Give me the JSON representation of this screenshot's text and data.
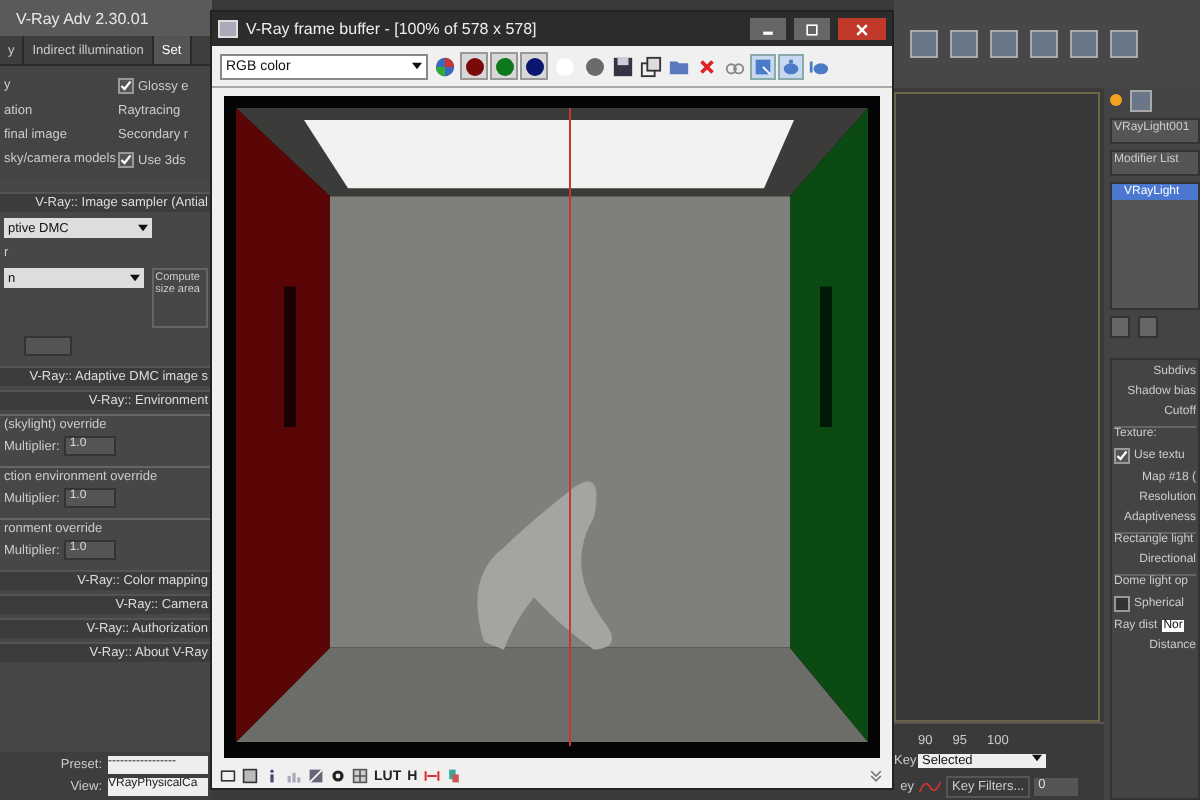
{
  "render_setup": {
    "title": "V-Ray Adv 2.30.01",
    "tabs": [
      {
        "label": "y",
        "selected": false
      },
      {
        "label": "Indirect illumination",
        "selected": false
      },
      {
        "label": "Set",
        "selected": true
      }
    ],
    "rows": [
      {
        "kind": "check-pair",
        "left": "y",
        "right": "Glossy e",
        "checked": true
      },
      {
        "kind": "pair",
        "left": "ation",
        "right": "Raytracing"
      },
      {
        "kind": "pair",
        "left": "final image",
        "right": "Secondary r"
      },
      {
        "kind": "check-pair",
        "left": "sky/camera models",
        "right": "Use 3ds",
        "checked": true
      }
    ],
    "items": [
      {
        "kind": "header",
        "title": "V-Ray:: Image sampler (Antial"
      },
      {
        "kind": "dropdown",
        "value": "ptive DMC"
      },
      {
        "kind": "label",
        "text": "r"
      },
      {
        "kind": "dropdown-note",
        "value": "n",
        "note": "Compute size area"
      },
      {
        "kind": "spinner"
      },
      {
        "kind": "header",
        "title": "V-Ray:: Adaptive DMC image s"
      },
      {
        "kind": "header",
        "title": "V-Ray:: Environment"
      },
      {
        "kind": "group",
        "title": "(skylight) override",
        "label": "Multiplier:",
        "value": "1.0"
      },
      {
        "kind": "group",
        "title": "ction environment override",
        "label": "Multiplier:",
        "value": "1.0"
      },
      {
        "kind": "group",
        "title": "ronment override",
        "label": "Multiplier:",
        "value": "1.0"
      },
      {
        "kind": "header",
        "title": "V-Ray:: Color mapping"
      },
      {
        "kind": "header",
        "title": "V-Ray:: Camera"
      },
      {
        "kind": "header",
        "title": "V-Ray:: Authorization"
      },
      {
        "kind": "header",
        "title": "V-Ray:: About V-Ray"
      }
    ],
    "preset": {
      "label": "Preset:",
      "value": "-----------------"
    },
    "view": {
      "label": "View:",
      "value": "VRayPhysicalCa"
    }
  },
  "frame_buffer": {
    "title": "V-Ray frame buffer - [100% of 578 x 578]",
    "channel_dropdown": "RGB color",
    "channels": [
      {
        "color": "#7a0a0a",
        "selected": true
      },
      {
        "color": "#0c7a1c",
        "selected": true
      },
      {
        "color": "#0a1670",
        "selected": true
      },
      {
        "color": "#ffffff",
        "selected": false
      },
      {
        "color": "#6a6a6a",
        "selected": false
      }
    ],
    "bottom_labels": [
      "LUT",
      "H"
    ]
  },
  "timeline": {
    "ticks": [
      "90",
      "95",
      "100"
    ],
    "key_labels": [
      "Key",
      "ey"
    ],
    "key_mode": "Selected",
    "key_filters": "Key Filters...",
    "frame": "0"
  },
  "command_panel": {
    "object_name": "VRayLight001",
    "modifier_list": "Modifier List",
    "stack": [
      {
        "label": "VRayLight",
        "selected": true
      }
    ],
    "params": [
      {
        "kind": "label",
        "text": "Subdivs"
      },
      {
        "kind": "label",
        "text": "Shadow bias"
      },
      {
        "kind": "label",
        "text": "Cutoff"
      },
      {
        "kind": "group",
        "text": "Texture:"
      },
      {
        "kind": "check",
        "text": "Use textu",
        "checked": true
      },
      {
        "kind": "label",
        "text": "Map #18 ("
      },
      {
        "kind": "label",
        "text": "Resolution"
      },
      {
        "kind": "label",
        "text": "Adaptiveness"
      },
      {
        "kind": "group",
        "text": "Rectangle light"
      },
      {
        "kind": "label",
        "text": "Directional"
      },
      {
        "kind": "group",
        "text": "Dome light op"
      },
      {
        "kind": "check",
        "text": "Spherical",
        "checked": false
      },
      {
        "kind": "field",
        "text": "Ray dist",
        "value": "Nor"
      },
      {
        "kind": "label",
        "text": "Distance"
      }
    ]
  }
}
